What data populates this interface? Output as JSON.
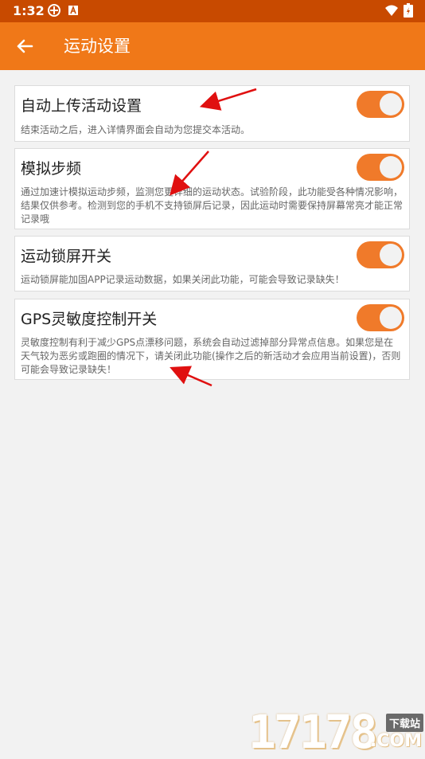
{
  "status": {
    "time": "1:32"
  },
  "toolbar": {
    "title": "运动设置"
  },
  "settings": [
    {
      "title": "自动上传活动设置",
      "desc": "结束活动之后，进入详情界面会自动为您提交本活动。",
      "enabled": true
    },
    {
      "title": "模拟步频",
      "desc": "通过加速计模拟运动步频，监测您更详细的运动状态。试验阶段，此功能受各种情况影响，结果仅供参考。检测到您的手机不支持锁屏后记录，因此运动时需要保持屏幕常亮才能正常记录哦",
      "enabled": true
    },
    {
      "title": "运动锁屏开关",
      "desc": "运动锁屏能加固APP记录运动数据，如果关闭此功能，可能会导致记录缺失！",
      "enabled": true
    },
    {
      "title": "GPS灵敏度控制开关",
      "desc": "灵敏度控制有利于减少GPS点漂移问题，系统会自动过滤掉部分异常点信息。如果您是在天气较为恶劣或跑圈的情况下，请关闭此功能(操作之后的新活动才会应用当前设置)，否则可能会导致记录缺失！",
      "enabled": true
    }
  ],
  "watermark": {
    "number": "17178",
    "badge": "下载站",
    "suffix": ".COM"
  },
  "colors": {
    "toolbar": "#f07818",
    "statusbar": "#c84a00",
    "toggle_on": "#f07a2a",
    "arrow": "#e01010"
  }
}
